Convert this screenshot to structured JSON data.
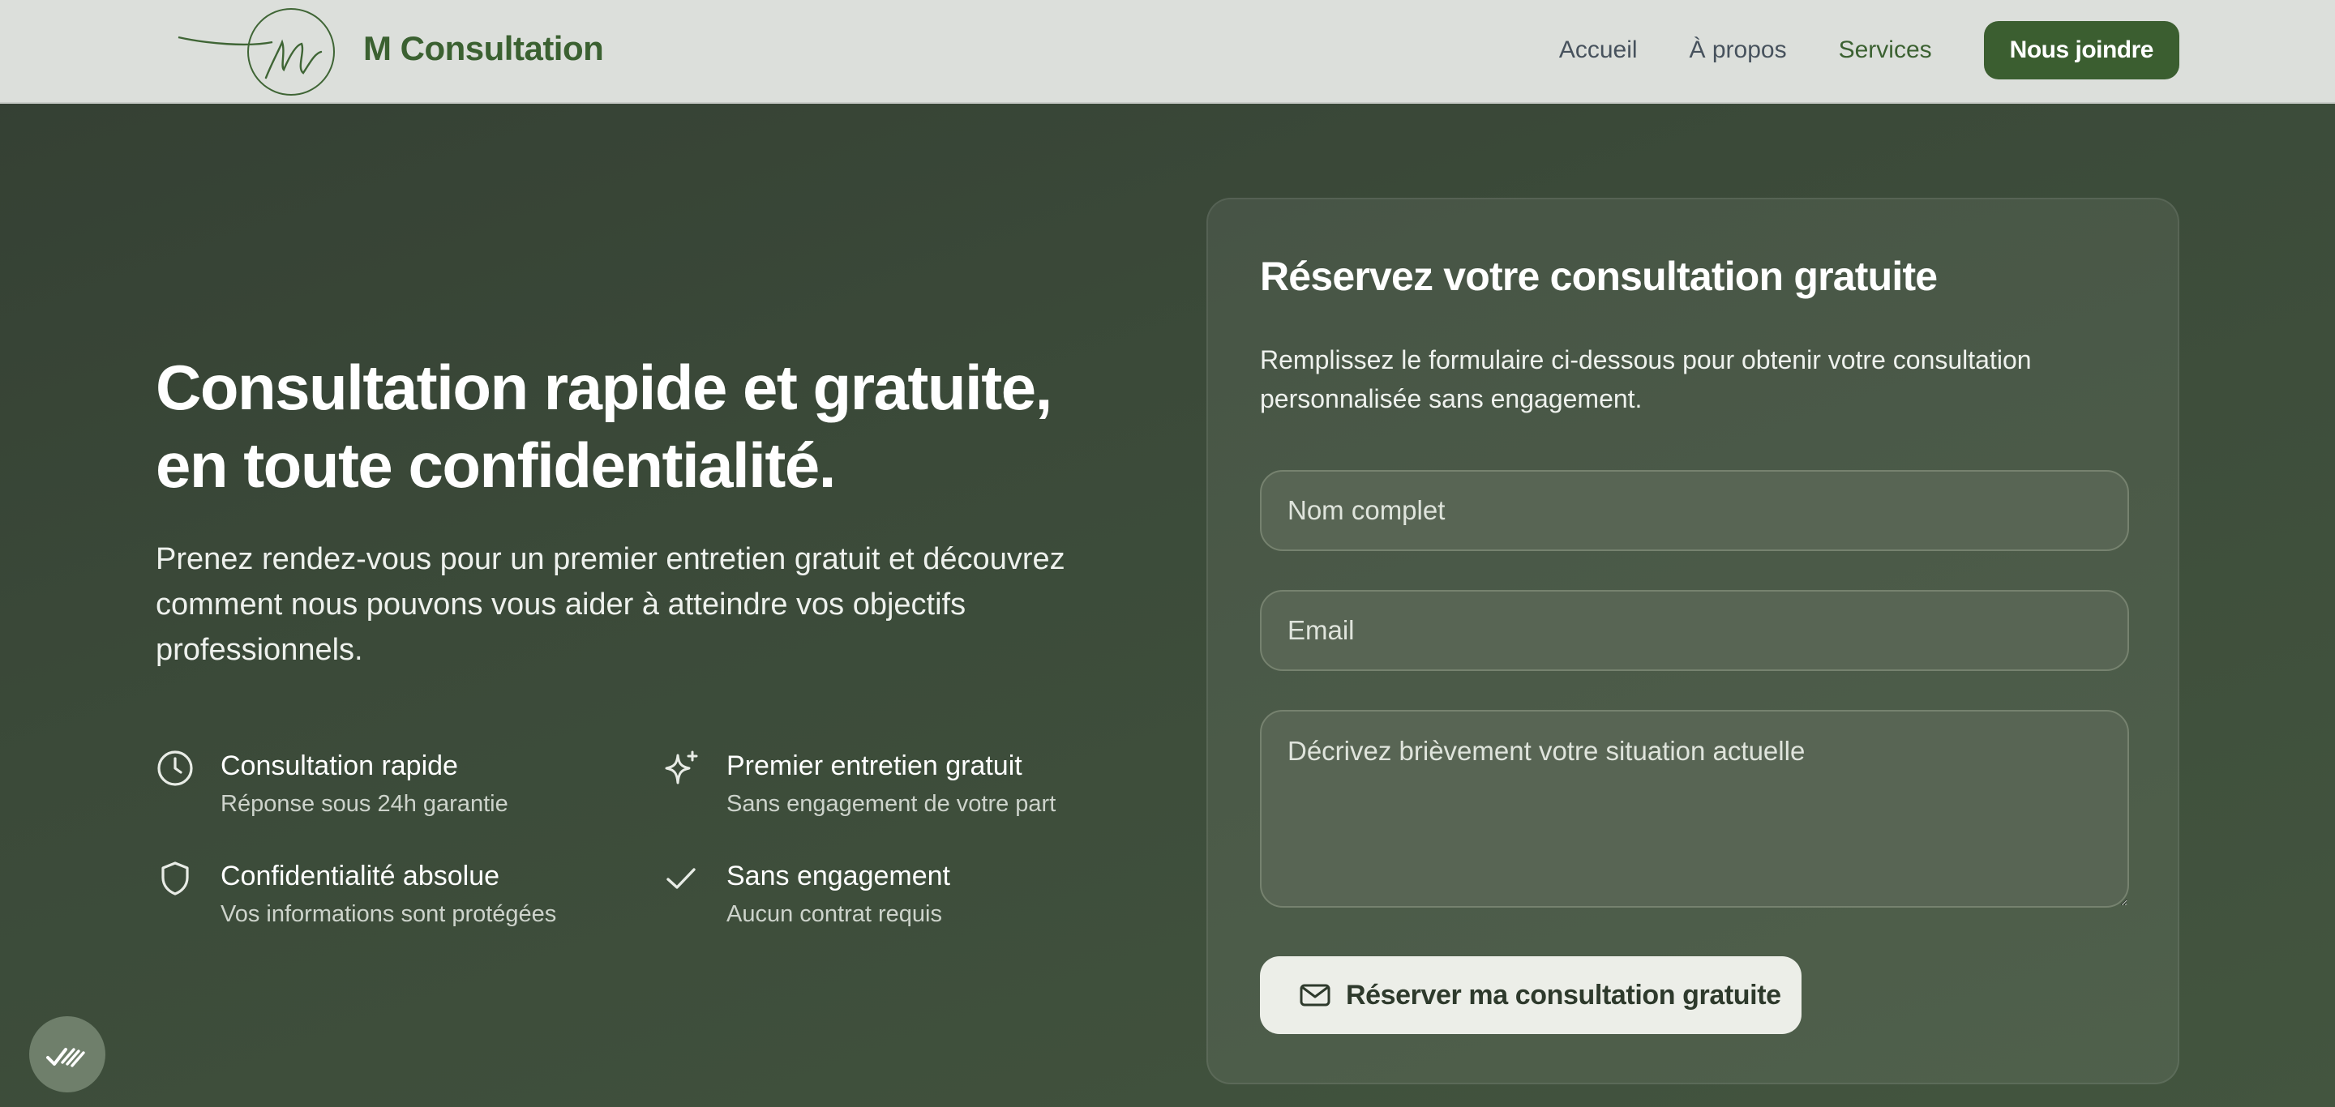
{
  "header": {
    "brand": "M Consultation",
    "nav": [
      "Accueil",
      "À propos",
      "Services"
    ],
    "cta": "Nous joindre"
  },
  "hero": {
    "title_line1": "Consultation rapide et gratuite,",
    "title_line2": "en toute confidentialité.",
    "subtitle": "Prenez rendez-vous pour un premier entretien gratuit et découvrez comment nous pouvons vous aider à atteindre vos objectifs professionnels.",
    "features": [
      {
        "icon": "clock-icon",
        "title": "Consultation rapide",
        "desc": "Réponse sous 24h garantie"
      },
      {
        "icon": "sparkle-icon",
        "title": "Premier entretien gratuit",
        "desc": "Sans engagement de votre part"
      },
      {
        "icon": "shield-icon",
        "title": "Confidentialité absolue",
        "desc": "Vos informations sont protégées"
      },
      {
        "icon": "check-icon",
        "title": "Sans engagement",
        "desc": "Aucun contrat requis"
      }
    ]
  },
  "form": {
    "title": "Réservez votre consultation gratuite",
    "description": "Remplissez le formulaire ci-dessous pour obtenir votre consultation personnalisée sans engagement.",
    "name_placeholder": "Nom complet",
    "email_placeholder": "Email",
    "message_placeholder": "Décrivez brièvement votre situation actuelle",
    "submit_label": "Réserver ma consultation gratuite",
    "submit_icon": "mail-icon"
  },
  "colors": {
    "accent": "#3b5e30",
    "header_bg": "#dcdfdb",
    "page_bg": "#3b4a39"
  }
}
